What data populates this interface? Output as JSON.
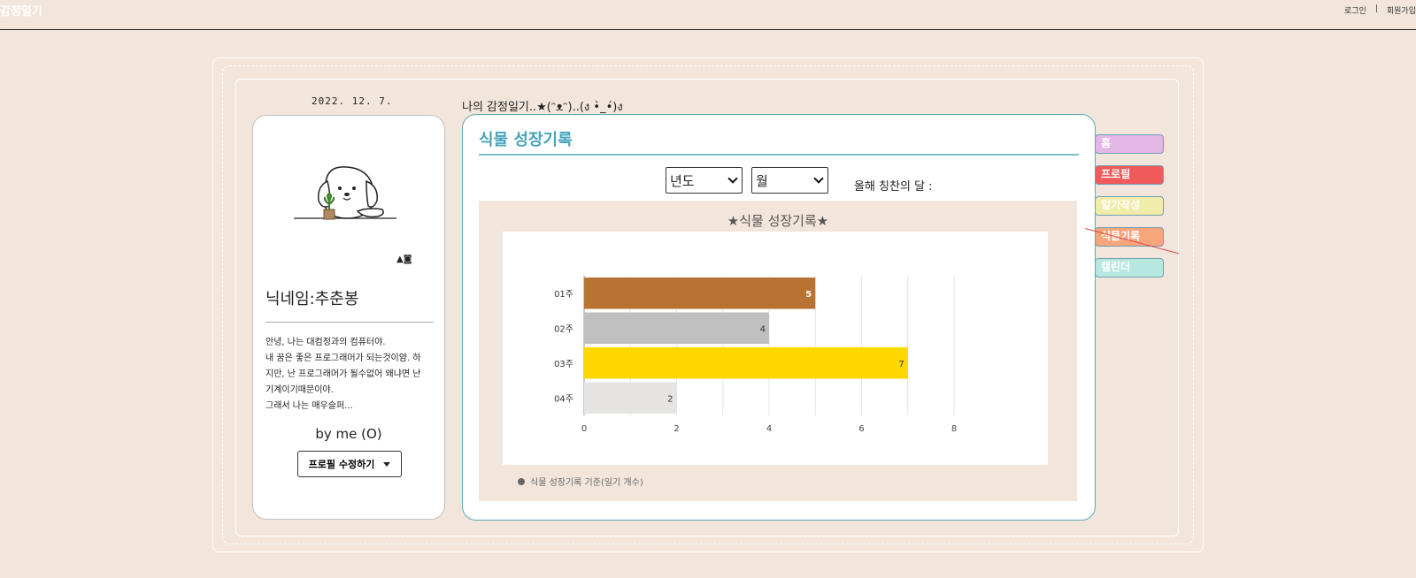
{
  "header": {
    "site_title": "감정일기",
    "login": "로그인",
    "sep": "|",
    "signup": "회원가입"
  },
  "date": "2022. 12. 7.",
  "diary_title": "나의 감정일기..★(ᵔᴥᵔ)..(ง •̀_•́)ง",
  "profile": {
    "nickname": "닉네임:추춘봉",
    "bio": [
      "안녕, 나는 대컴정과의 컴퓨터야.",
      "내 꿈은 좋은 프로그래머가 되는것이얌. 하",
      "지만, 난 프로그래머가 될수없어 왜냐면 난",
      "기계이기때문이야.",
      "그래서 나는 매우슬퍼..."
    ],
    "byline": "by me (O)",
    "edit_button": "프로필 수정하기",
    "mini_icon": "▲◙"
  },
  "main": {
    "title": "식물 성장기록",
    "year_select": "년도",
    "month_select": "월",
    "praise_label": "올해 칭찬의 달 :"
  },
  "tabs": [
    {
      "label": "홈",
      "color": "#e2b7e6"
    },
    {
      "label": "프로필",
      "color": "#f05a5a"
    },
    {
      "label": "일기작성",
      "color": "#f0ecaa"
    },
    {
      "label": "식물기록",
      "color": "#f7a57a"
    },
    {
      "label": "캘린더",
      "color": "#b7e8e0"
    }
  ],
  "chart_data": {
    "type": "bar",
    "orientation": "horizontal",
    "title": "★식물 성장기록★",
    "categories": [
      "01주",
      "02주",
      "03주",
      "04주"
    ],
    "values": [
      5,
      4,
      7,
      2
    ],
    "colors": [
      "#b87333",
      "#c0c0c0",
      "#ffd700",
      "#e5e4e2"
    ],
    "xlim": [
      0,
      8
    ],
    "xticks": [
      0,
      2,
      4,
      6,
      8
    ],
    "legend": "식물 성장기록 기준(일기 개수)",
    "grid": true
  }
}
